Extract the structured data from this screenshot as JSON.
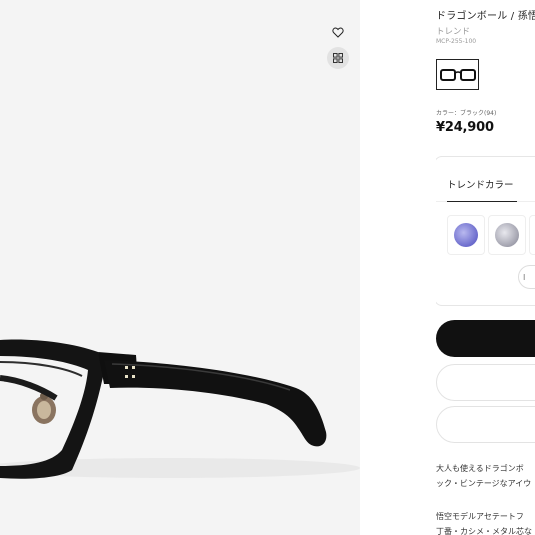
{
  "product": {
    "title": "ドラゴンボール / 孫悟",
    "brand": "トレンド",
    "sku": "MCP-255-100",
    "color_label": "カラー：ブラック(94)",
    "price": "¥24,900"
  },
  "lens_card": {
    "tab_label": "トレンドカラー",
    "swatch_colors": [
      "#7d7dd6",
      "#b3b3bf"
    ],
    "pill_text": "I"
  },
  "description": {
    "line1": "大人も使えるドラゴンボ",
    "line2": "ック・ビンテージなアイウ",
    "line3": "悟空モデルアセテートフ",
    "line4": "丁番・カシメ・メタル芯な"
  },
  "icons": {
    "wishlist": "heart-icon",
    "zoom": "grid-icon"
  },
  "colors": {
    "primary_button": "#111111",
    "gallery_background": "#f4f4f4"
  }
}
